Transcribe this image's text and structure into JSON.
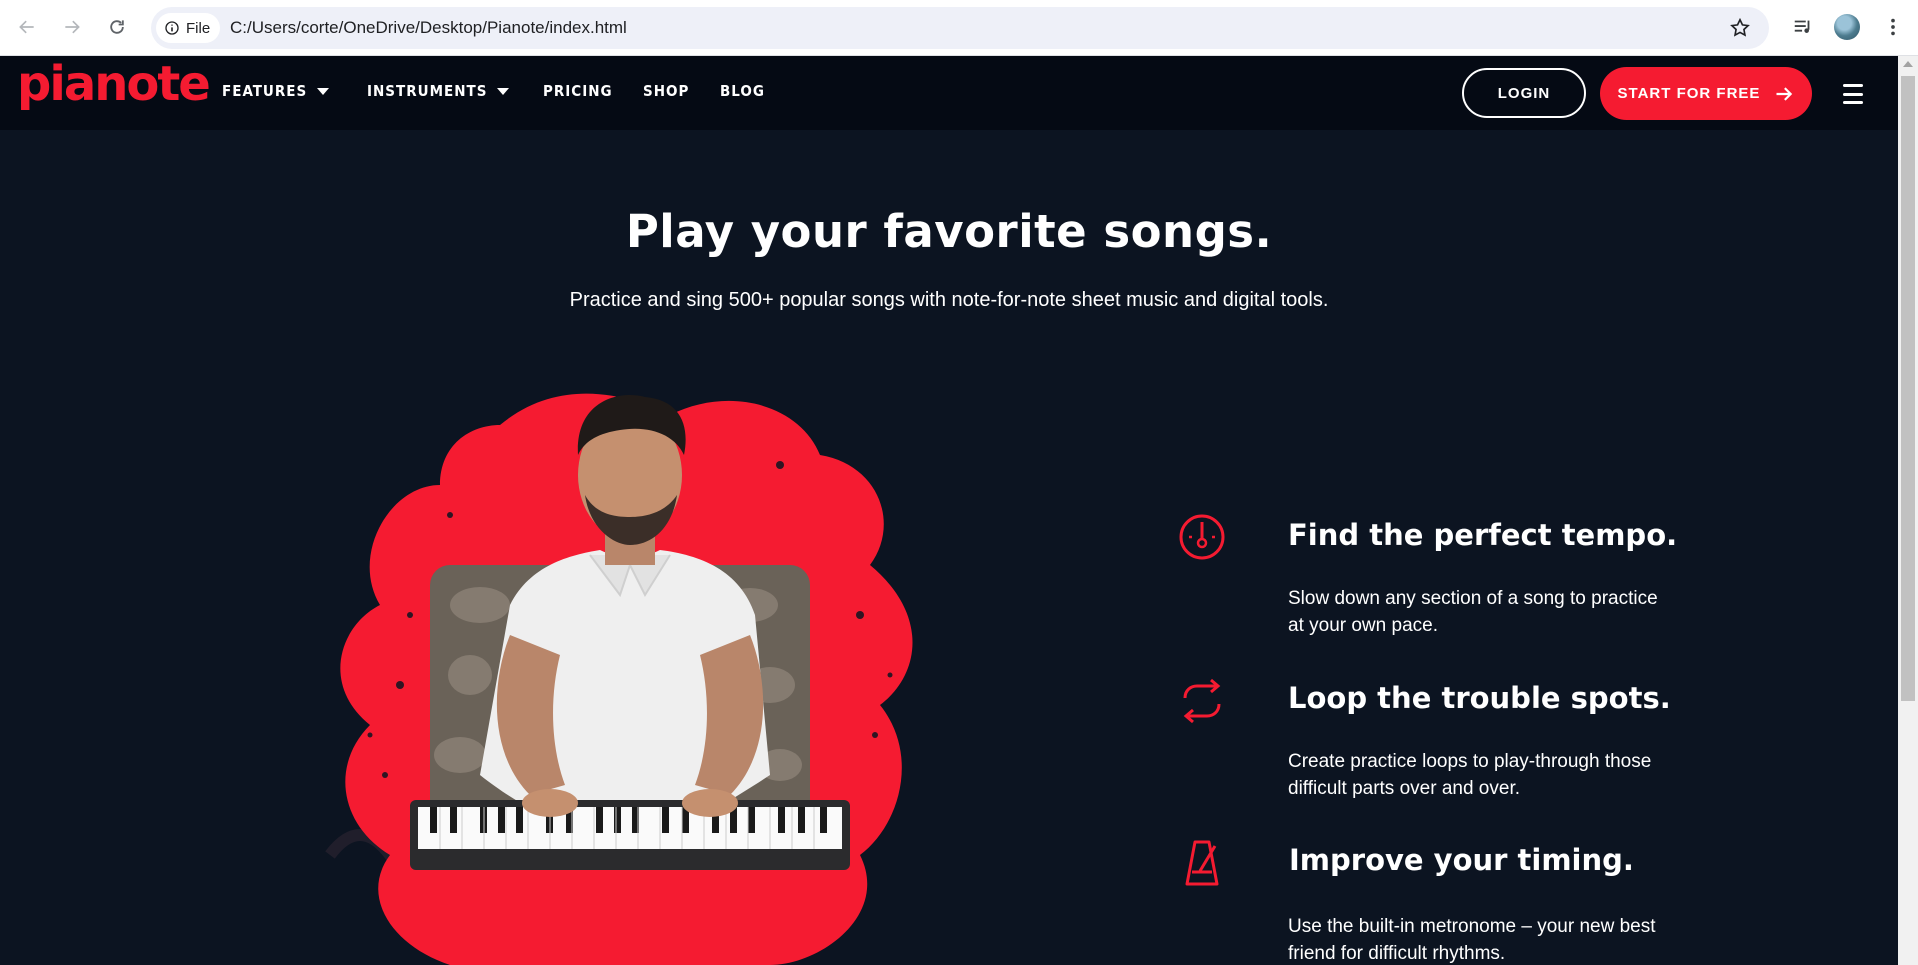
{
  "browser": {
    "chip_label": "File",
    "url": "C:/Users/corte/OneDrive/Desktop/Pianote/index.html",
    "icons": [
      "back-arrow-icon",
      "forward-arrow-icon",
      "reload-icon",
      "info-icon",
      "star-icon",
      "media-queue-icon",
      "avatar",
      "kebab-menu-icon"
    ]
  },
  "header": {
    "logo": "pianote",
    "menu": [
      {
        "label": "FEATURES",
        "dropdown": true
      },
      {
        "label": "INSTRUMENTS",
        "dropdown": true
      },
      {
        "label": "PRICING",
        "dropdown": false
      },
      {
        "label": "SHOP",
        "dropdown": false
      },
      {
        "label": "BLOG",
        "dropdown": false
      }
    ],
    "login_label": "LOGIN",
    "cta_label": "START FOR FREE"
  },
  "hero": {
    "title": "Play your favorite songs.",
    "subtitle": "Practice and sing 500+ popular songs with note-for-note sheet music and digital tools."
  },
  "features": [
    {
      "icon": "tempo-dial-icon",
      "title": "Find the perfect tempo.",
      "description": "Slow down any section of a song to practice at your own pace."
    },
    {
      "icon": "loop-icon",
      "title": "Loop the trouble spots.",
      "description": "Create practice loops to play-through those difficult parts over and over."
    },
    {
      "icon": "metronome-icon",
      "title": "Improve your timing.",
      "description": "Use the built-in metronome – your new best friend for difficult rhythms."
    }
  ],
  "colors": {
    "brand_red": "#f51b31",
    "page_bg": "#0c1421",
    "header_bg": "#050a14"
  }
}
